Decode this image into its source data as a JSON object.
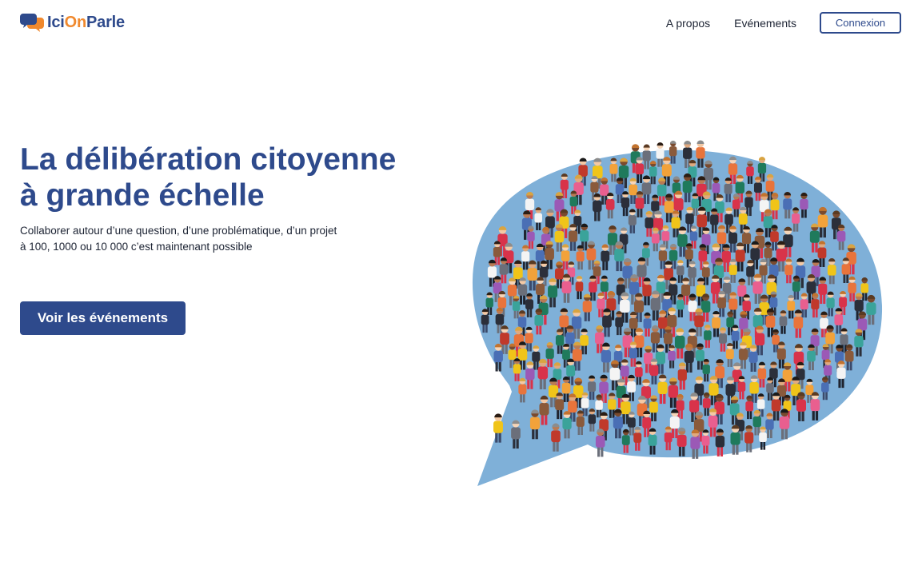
{
  "brand": {
    "name_part1": "Ici",
    "name_part2": "On",
    "name_part3": "Parle",
    "colors": {
      "primary": "#2e4a8c",
      "accent": "#f0892e",
      "bubble": "#7fb0d8"
    }
  },
  "nav": {
    "items": [
      {
        "label": "A propos"
      },
      {
        "label": "Evénements"
      }
    ],
    "login_label": "Connexion"
  },
  "hero": {
    "title_line1": "La délibération citoyenne",
    "title_line2": "à grande échelle",
    "subtitle_line1": "Collaborer autour d’une question, d’une problématique, d’un projet",
    "subtitle_line2": "à 100, 1000 ou 10 000 c’est maintenant possible",
    "cta_label": "Voir les événements"
  },
  "illustration": {
    "icon": "crowd-speech-bubble-illustration"
  }
}
